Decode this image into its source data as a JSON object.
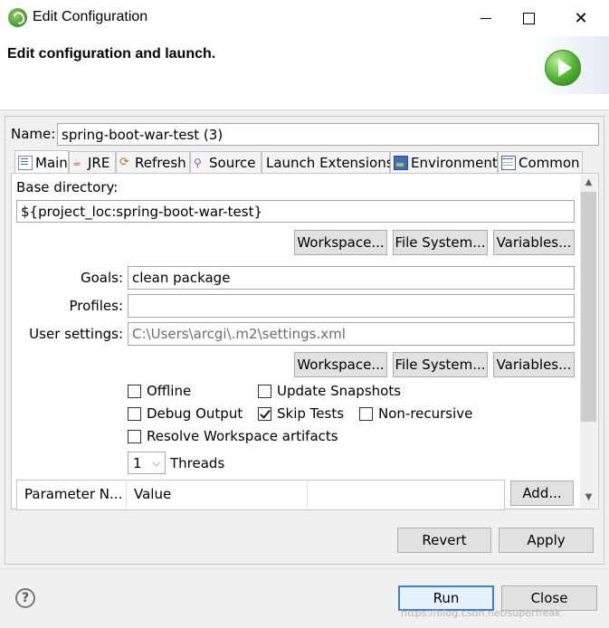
{
  "window": {
    "title": "Edit Configuration",
    "header": "Edit configuration and launch."
  },
  "name": {
    "label": "Name:",
    "value": "spring-boot-war-test (3)"
  },
  "tabs": [
    {
      "label": "Main",
      "icon": "main-tab-icon",
      "active": true
    },
    {
      "label": "JRE",
      "icon": "jre-icon"
    },
    {
      "label": "Refresh",
      "icon": "refresh-icon"
    },
    {
      "label": "Source",
      "icon": "source-icon"
    },
    {
      "label": "Launch Extensions"
    },
    {
      "label": "Environment",
      "icon": "environment-icon"
    },
    {
      "label": "Common",
      "icon": "common-icon"
    }
  ],
  "main": {
    "base_dir_label": "Base directory:",
    "base_dir_value": "${project_loc:spring-boot-war-test}",
    "buttons": {
      "workspace": "Workspace...",
      "file_system": "File System...",
      "variables": "Variables..."
    },
    "goals_label": "Goals:",
    "goals_value": "clean package",
    "profiles_label": "Profiles:",
    "profiles_value": "",
    "user_settings_label": "User settings:",
    "user_settings_value": "C:\\Users\\arcgi\\.m2\\settings.xml",
    "checkboxes": {
      "offline": {
        "label": "Offline",
        "checked": false
      },
      "update_snapshots": {
        "label": "Update Snapshots",
        "checked": false
      },
      "debug_output": {
        "label": "Debug Output",
        "checked": false
      },
      "skip_tests": {
        "label": "Skip Tests",
        "checked": true
      },
      "non_recursive": {
        "label": "Non-recursive",
        "checked": false
      },
      "resolve_workspace": {
        "label": "Resolve Workspace artifacts",
        "checked": false
      }
    },
    "threads_value": "1",
    "threads_label": "Threads",
    "table_headers": [
      "Parameter N...",
      "Value"
    ],
    "add_button": "Add..."
  },
  "footer": {
    "revert": "Revert",
    "apply": "Apply",
    "run": "Run",
    "close": "Close",
    "help": "?",
    "watermark": "https://blog.csdn.net/superfreak"
  },
  "colors": {
    "accent": "#3c7fd1",
    "run_icon": "#4cb12d"
  }
}
